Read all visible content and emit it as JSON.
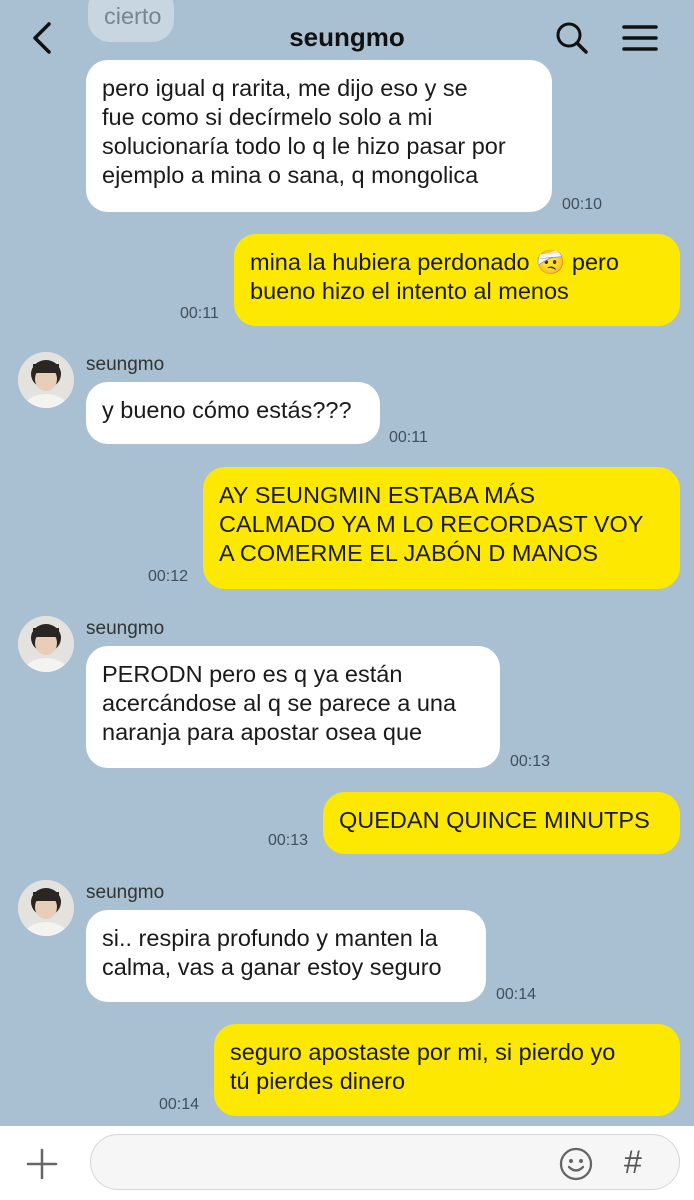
{
  "header": {
    "title": "seungmo"
  },
  "messages": [
    {
      "side": "in",
      "text": "cierto"
    },
    {
      "side": "in",
      "text": "pero igual q rarita, me dijo eso y se fue como si decírmelo solo a mi solucionaría todo lo q le hizo pasar por ejemplo a mina o sana, q mongolica",
      "time": "00:10"
    },
    {
      "side": "out",
      "text": "mina la hubiera perdonado 🤕 pero bueno hizo el intento al menos",
      "time": "00:11"
    },
    {
      "side": "in",
      "sender": "seungmo",
      "text": "y bueno cómo estás???",
      "time": "00:11"
    },
    {
      "side": "out",
      "text": "AY SEUNGMIN ESTABA MÁS CALMADO YA M LO RECORDAST VOY A COMERME EL JABÓN D MANOS",
      "time": "00:12"
    },
    {
      "side": "in",
      "sender": "seungmo",
      "text": "PERODN pero es q ya están acercándose al q se parece a una naranja para apostar osea que",
      "time": "00:13"
    },
    {
      "side": "out",
      "text": "QUEDAN QUINCE MINUTPS",
      "time": "00:13"
    },
    {
      "side": "in",
      "sender": "seungmo",
      "text": "si.. respira profundo y manten la calma, vas a ganar estoy seguro",
      "time": "00:14"
    },
    {
      "side": "out",
      "text": "seguro apostaste por mi, si pierdo yo tú pierdes dinero",
      "time": "00:14"
    }
  ],
  "lines": {
    "m1": [
      "pero igual q rarita, me dijo eso y se",
      "fue como si decírmelo solo a mi",
      "solucionaría todo lo q le hizo pasar por",
      "ejemplo a mina o sana, q mongolica"
    ],
    "m2": [
      "mina la hubiera perdonado 🤕 pero",
      "bueno hizo el intento al menos"
    ],
    "m4": [
      "AY SEUNGMIN ESTABA MÁS",
      "CALMADO YA M LO RECORDAST VOY",
      "A COMERME EL JABÓN D MANOS"
    ],
    "m5": [
      "PERODN pero es q ya están",
      "acercándose al q se parece a una",
      "naranja para apostar osea que"
    ],
    "m7": [
      "si.. respira profundo y manten la",
      "calma, vas a ganar estoy seguro"
    ],
    "m8": [
      "seguro apostaste por mi, si pierdo yo",
      "tú pierdes dinero"
    ]
  },
  "icons": {
    "back": "back-arrow-icon",
    "search": "search-icon",
    "menu": "menu-icon",
    "plus": "plus-icon",
    "emoji": "emoji-icon",
    "hash": "hashtag-icon"
  },
  "colors": {
    "background": "#a9c0d2",
    "outgoing": "#fde801",
    "incoming": "#ffffff"
  },
  "input": {
    "hash_label": "#"
  }
}
